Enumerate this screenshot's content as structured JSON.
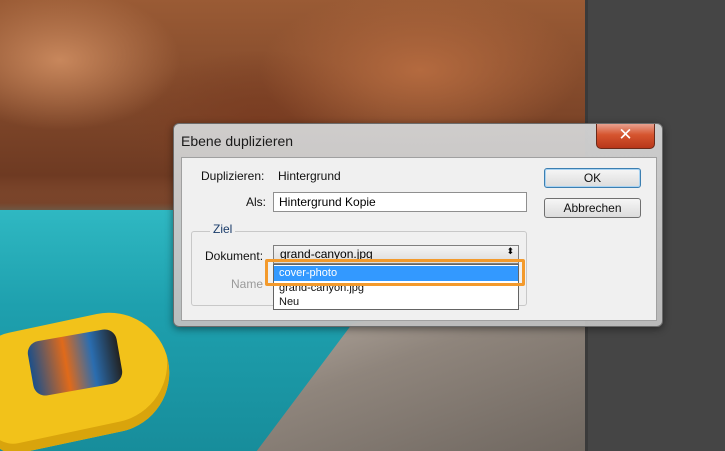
{
  "dialog": {
    "title": "Ebene duplizieren",
    "close_glyph": "✕",
    "duplicate_label": "Duplizieren:",
    "duplicate_value": "Hintergrund",
    "as_label": "Als:",
    "as_value": "Hintergrund Kopie",
    "ok_label": "OK",
    "cancel_label": "Abbrechen",
    "group_label": "Ziel",
    "document_label": "Dokument:",
    "document_selected": "grand-canyon.jpg",
    "document_options": [
      "cover-photo",
      "grand-canyon.jpg",
      "Neu"
    ],
    "name_label": "Name"
  },
  "colors": {
    "highlight": "#f39a2c",
    "selection": "#3399ff"
  }
}
